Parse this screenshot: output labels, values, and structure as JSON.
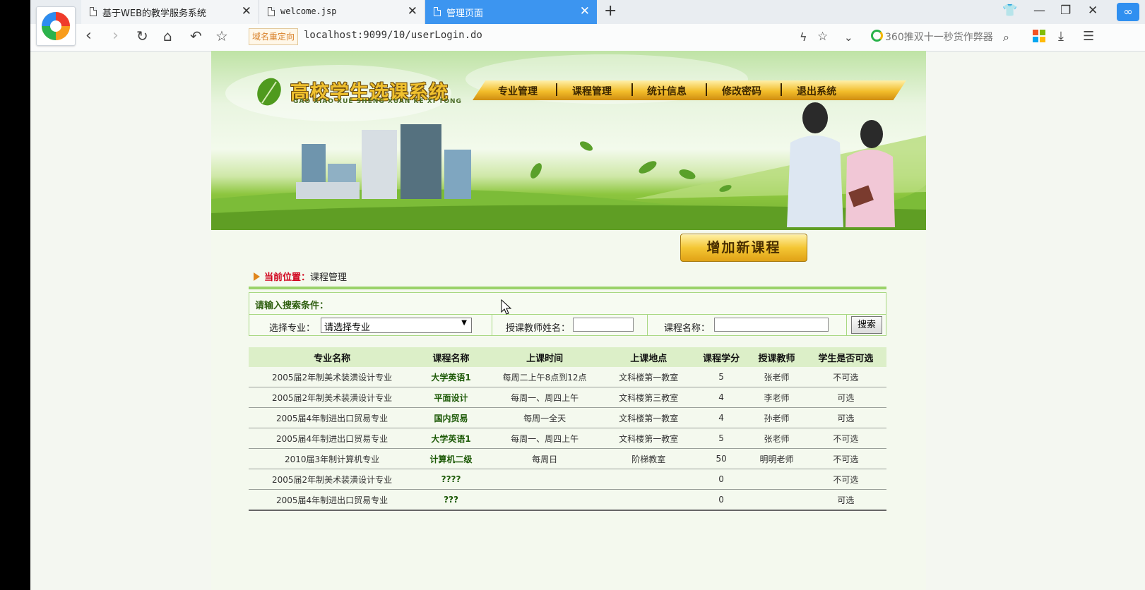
{
  "browser": {
    "tabs": [
      {
        "title": "基于WEB的教学服务系统",
        "active": false
      },
      {
        "title": "welcome.jsp",
        "active": false
      },
      {
        "title": "管理页面",
        "active": true
      }
    ],
    "redirect_badge": "域名重定向",
    "url": "localhost:9099/10/userLogin.do",
    "search_hint": "360推双十一秒货作弊器"
  },
  "banner": {
    "title": "高校学生选课系统",
    "subtitle": "GAO XIAO XUE SHENG XUAN KE XI TONG",
    "menu": [
      "专业管理",
      "课程管理",
      "统计信息",
      "修改密码",
      "退出系统"
    ]
  },
  "add_course_button": "增加新课程",
  "breadcrumb": {
    "label": "当前位置：",
    "value": "课程管理"
  },
  "search": {
    "heading": "请输入搜索条件：",
    "major_label": "选择专业：",
    "major_selected": "请选择专业",
    "teacher_label": "授课教师姓名：",
    "teacher_value": "",
    "course_label": "课程名称：",
    "course_value": "",
    "button": "搜索"
  },
  "table": {
    "headers": [
      "专业名称",
      "课程名称",
      "上课时间",
      "上课地点",
      "课程学分",
      "授课教师",
      "学生是否可选"
    ],
    "rows": [
      [
        "2005届2年制美术装潢设计专业",
        "大学英语1",
        "每周二上午8点到12点",
        "文科楼第一教室",
        "5",
        "张老师",
        "不可选"
      ],
      [
        "2005届2年制美术装潢设计专业",
        "平面设计",
        "每周一、周四上午",
        "文科楼第三教室",
        "4",
        "李老师",
        "可选"
      ],
      [
        "2005届4年制进出口贸易专业",
        "国内贸易",
        "每周一全天",
        "文科楼第一教室",
        "4",
        "孙老师",
        "可选"
      ],
      [
        "2005届4年制进出口贸易专业",
        "大学英语1",
        "每周一、周四上午",
        "文科楼第一教室",
        "5",
        "张老师",
        "不可选"
      ],
      [
        "2010届3年制计算机专业",
        "计算机二级",
        "每周日",
        "阶梯教室",
        "50",
        "明明老师",
        "不可选"
      ],
      [
        "2005届2年制美术装潢设计专业",
        "????",
        "",
        "",
        "0",
        "",
        "不可选"
      ],
      [
        "2005届4年制进出口贸易专业",
        "???",
        "",
        "",
        "0",
        "",
        "可选"
      ]
    ]
  },
  "colors": {
    "tab_active": "#3c95f0",
    "breadcrumb_label": "#d0021b",
    "accent_green": "#9ad269",
    "button_gold": "#f4c634"
  }
}
